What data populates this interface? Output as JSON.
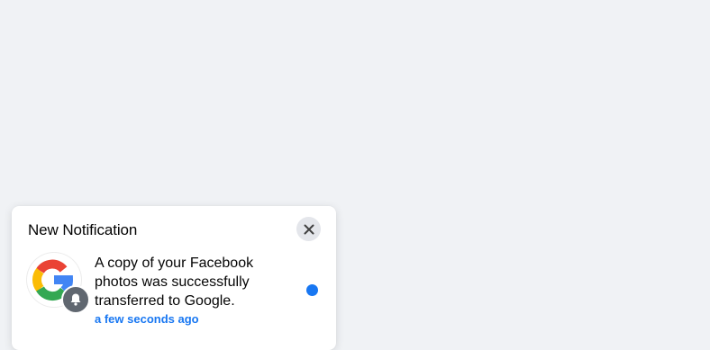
{
  "notification": {
    "title": "New Notification",
    "message": "A copy of your Facebook photos was successfully transferred to Google.",
    "timestamp": "a few seconds ago",
    "avatar_icon": "google-logo-icon",
    "badge_icon": "bell-icon",
    "close_icon": "close-icon",
    "unread": true,
    "colors": {
      "accent": "#1877f2",
      "badge": "#606770",
      "background": "#f0f2f5",
      "close_button_bg": "#e4e6eb"
    }
  }
}
